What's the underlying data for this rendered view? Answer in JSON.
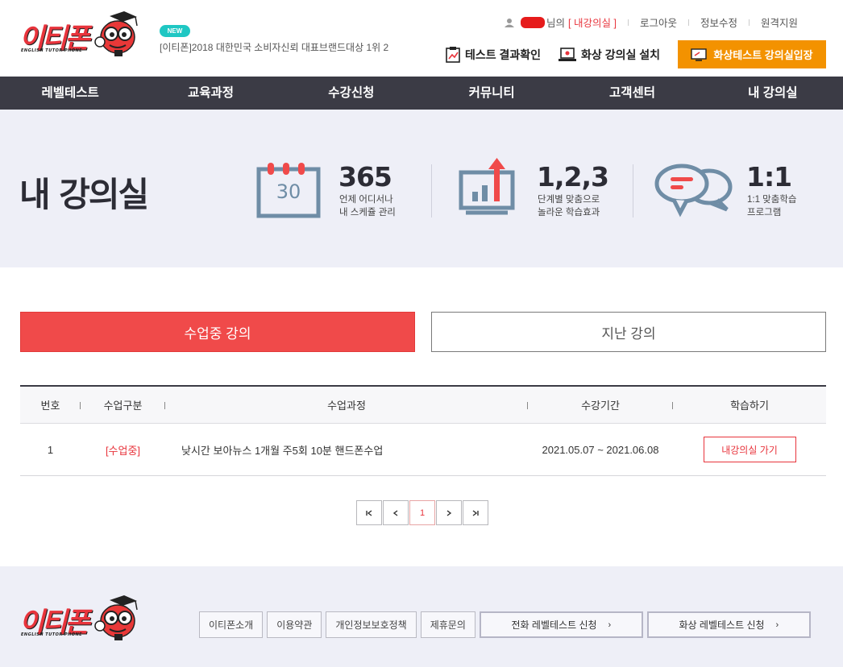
{
  "brand": {
    "logo_text": "이티폰",
    "logo_sub": "ENGLISH TUTOR PHONE"
  },
  "header": {
    "badge": "NEW",
    "headline": "[이티폰]2018 대한민국 소비자신뢰 대표브랜드대상 1위 2",
    "user_suffix": "님의",
    "my_class_link": "[ 내강의실 ]",
    "logout": "로그아웃",
    "edit_info": "정보수정",
    "remote_support": "원격지원",
    "test_result": "테스트 결과확인",
    "install": "화상 강의실 설치",
    "video_test_enter": "화상테스트 강의실입장"
  },
  "gnb": [
    "레벨테스트",
    "교육과정",
    "수강신청",
    "커뮤니티",
    "고객센터",
    "내 강의실"
  ],
  "hero": {
    "title": "내 강의실",
    "calendar_day": "30",
    "features": [
      {
        "num": "365",
        "line1": "언제 어디서나",
        "line2": "내 스케쥴 관리"
      },
      {
        "num": "1,2,3",
        "line1": "단계별 맞춤으로",
        "line2": "놀라운 학습효과"
      },
      {
        "num": "1:1",
        "line1": "1:1 맞춤학습",
        "line2": "프로그램"
      }
    ]
  },
  "tabs": {
    "active": "수업중 강의",
    "inactive": "지난 강의"
  },
  "table": {
    "headers": [
      "번호",
      "수업구분",
      "수업과정",
      "수강기간",
      "학습하기"
    ],
    "rows": [
      {
        "no": "1",
        "status": "[수업중]",
        "course": "낮시간 보아뉴스 1개월 주5회 10분 핸드폰수업",
        "period": "2021.05.07 ~ 2021.06.08",
        "action": "내강의실 가기"
      }
    ]
  },
  "pager": {
    "current": "1"
  },
  "footer": {
    "links": [
      "이티폰소개",
      "이용약관",
      "개인정보보호정책",
      "제휴문의"
    ],
    "buttons": [
      "전화 레벨테스트 신청",
      "화상 레벨테스트 신청"
    ],
    "arrow": "›"
  },
  "colors": {
    "accent": "#f04a4a",
    "orange": "#f39200",
    "nav": "#3b3b45",
    "teal": "#1fc7c3",
    "icon_blue": "#6f8da6"
  }
}
